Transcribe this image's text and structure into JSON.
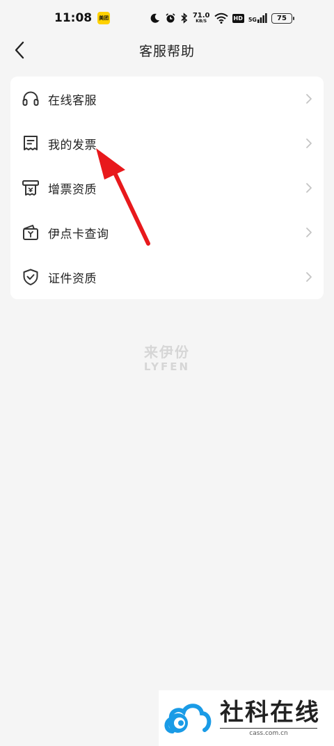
{
  "status_bar": {
    "time": "11:08",
    "app_badge": "美团",
    "net_speed_value": "71.0",
    "net_speed_unit": "KB/S",
    "hd": "HD",
    "network": "5G",
    "battery": "75"
  },
  "header": {
    "title": "客服帮助"
  },
  "menu": {
    "items": [
      {
        "label": "在线客服",
        "icon": "headset-icon"
      },
      {
        "label": "我的发票",
        "icon": "receipt-icon"
      },
      {
        "label": "增票资质",
        "icon": "printer-receipt-icon"
      },
      {
        "label": "伊点卡查询",
        "icon": "wallet-card-icon"
      },
      {
        "label": "证件资质",
        "icon": "shield-check-icon"
      }
    ]
  },
  "brand": {
    "cn": "来伊份",
    "en": "LYFEN"
  },
  "watermark": {
    "name": "社科在线",
    "domain": "cass.com.cn"
  },
  "colors": {
    "background": "#f5f5f5",
    "card": "#ffffff",
    "annotation_arrow": "#e8191c",
    "watermark_blue": "#1a9be6"
  }
}
